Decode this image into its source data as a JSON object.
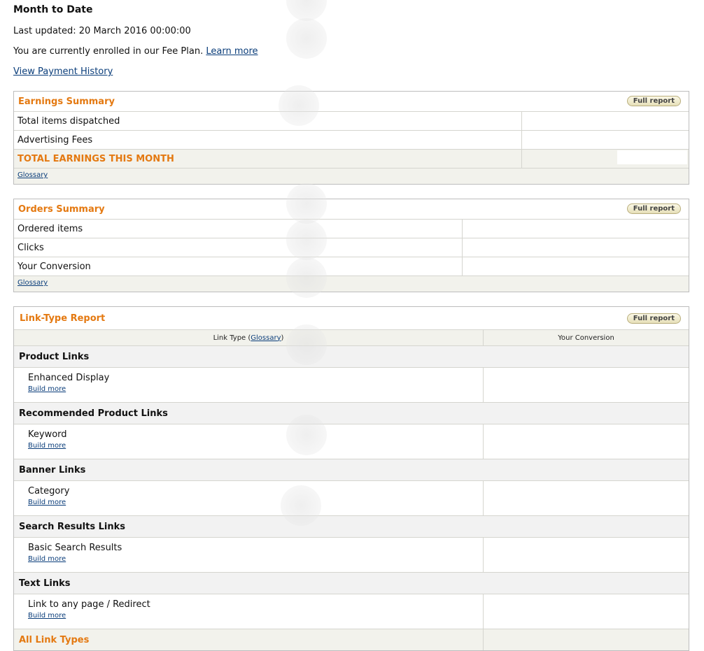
{
  "header": {
    "title": "Month to Date",
    "last_updated": "Last updated: 20 March 2016 00:00:00",
    "fee_plan_text": "You are currently enrolled in our Fee Plan.",
    "learn_more": "Learn more",
    "payment_history": "View Payment History"
  },
  "earnings": {
    "title": "Earnings Summary",
    "full_report": "Full report",
    "rows": [
      "Total items dispatched",
      "Advertising Fees"
    ],
    "total_label": "TOTAL EARNINGS THIS MONTH",
    "glossary": "Glossary"
  },
  "orders": {
    "title": "Orders Summary",
    "full_report": "Full report",
    "rows": [
      "Ordered items",
      "Clicks",
      "Your Conversion"
    ],
    "glossary": "Glossary"
  },
  "linktype": {
    "title": "Link-Type Report",
    "full_report": "Full report",
    "col_link_type": "Link Type (",
    "col_glossary": "Glossary",
    "col_close": ")",
    "col_conversion": "Your Conversion",
    "build_more": "Build more",
    "sections": [
      {
        "name": "Product Links",
        "item": "Enhanced Display"
      },
      {
        "name": "Recommended Product Links",
        "item": "Keyword"
      },
      {
        "name": "Banner Links",
        "item": "Category"
      },
      {
        "name": "Search Results Links",
        "item": "Basic Search Results"
      },
      {
        "name": "Text Links",
        "item": "Link to any page / Redirect"
      }
    ],
    "all_label": "All Link Types"
  },
  "colors": {
    "accent": "#e47911",
    "link": "#0a3d7a",
    "row_bg": "#f2f2ec"
  }
}
